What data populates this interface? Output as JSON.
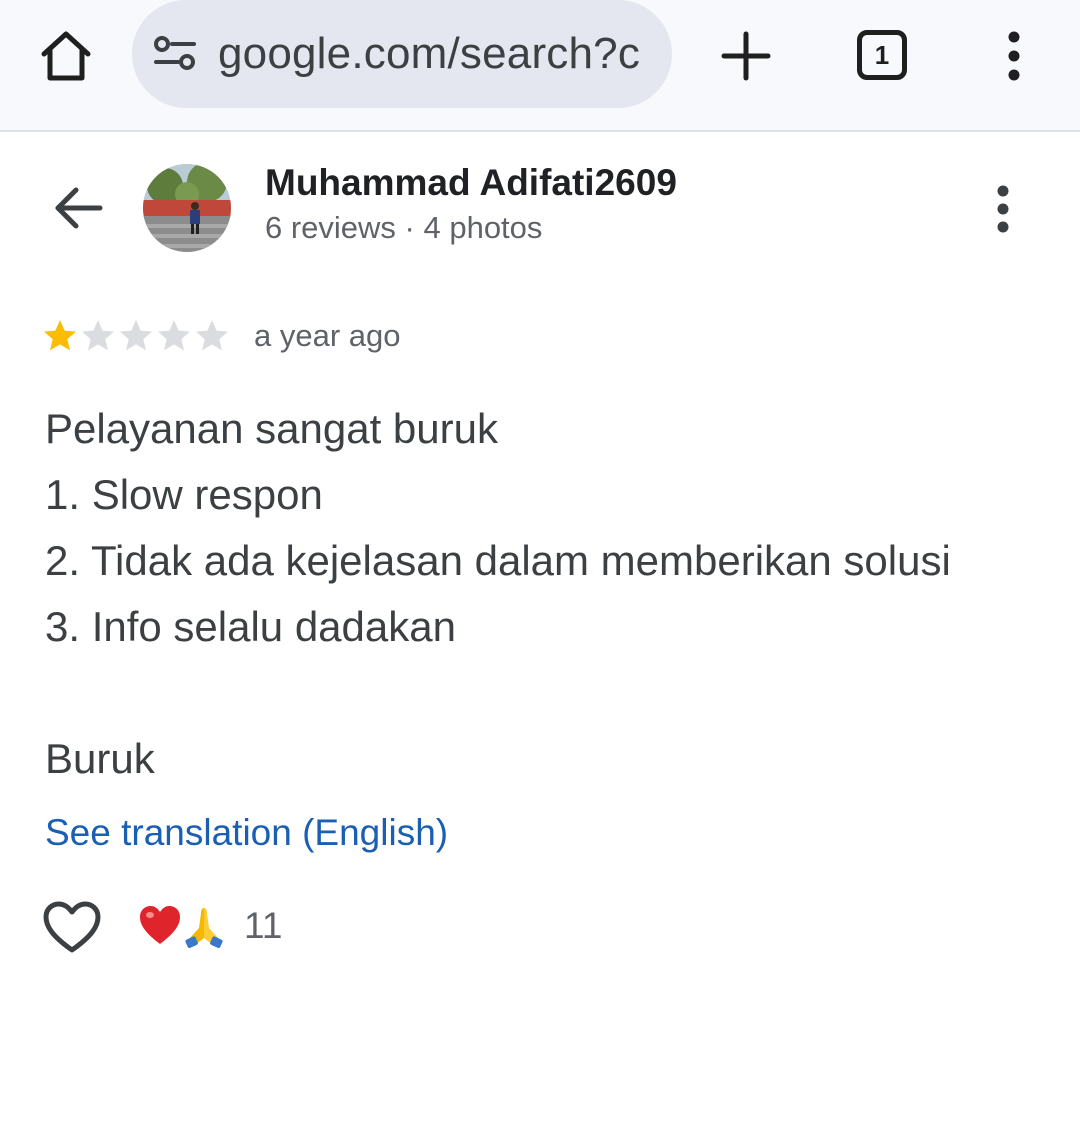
{
  "browser": {
    "url": "google.com/search?c",
    "tab_count": "1",
    "icons": [
      "home-icon",
      "site-info-icon",
      "plus-icon",
      "tab-switcher-icon",
      "more-vert-icon"
    ]
  },
  "reviewer": {
    "name": "Muhammad Adifati2609",
    "meta": "6 reviews · 4 photos"
  },
  "review": {
    "rating": 1,
    "rating_max": 5,
    "time": "a year ago",
    "lines": [
      "Pelayanan sangat buruk",
      "1. Slow respon",
      "2. Tidak ada kejelasan dalam memberikan solusi",
      "3. Info selalu dadakan",
      "",
      "Buruk"
    ],
    "see_translation": "See translation (English)"
  },
  "reactions": {
    "emojis": [
      "heart-icon",
      "folded-hands-icon"
    ],
    "count": "11"
  },
  "colors": {
    "star_filled": "#fbbc04",
    "star_empty": "#dadce0",
    "link": "#1a5fb4",
    "topbar_bg": "#f8f9fd",
    "omnibox_bg": "#e4e7ef"
  }
}
